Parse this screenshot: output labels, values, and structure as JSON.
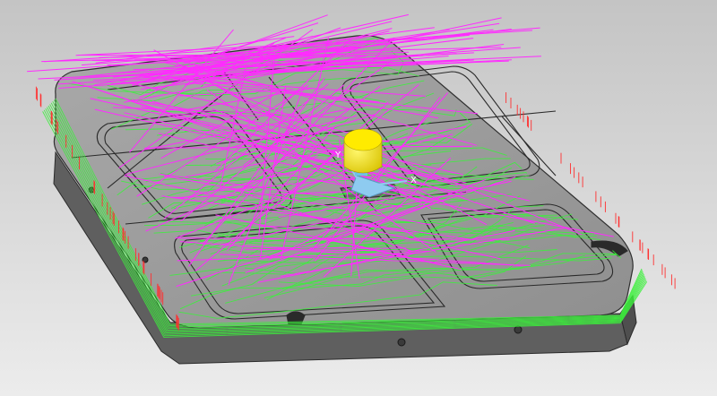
{
  "viewport": {
    "background_top": "#c4c4c4",
    "background_bottom": "#ececec"
  },
  "part": {
    "top_face_color": "#9c9c9c",
    "side_face_color": "#6d6d6d",
    "pocket_outline_color": "#2a2a2a"
  },
  "toolpath": {
    "rapid_color": "#ff2bff",
    "feed_color": "#3cf03c",
    "plunge_color": "#ff3030"
  },
  "tool": {
    "color": "#ffeb00",
    "shank_color": "#e6d000"
  },
  "triad": {
    "x_label": "X",
    "y_label": "Y",
    "axis_color": "#8ecbf0"
  }
}
